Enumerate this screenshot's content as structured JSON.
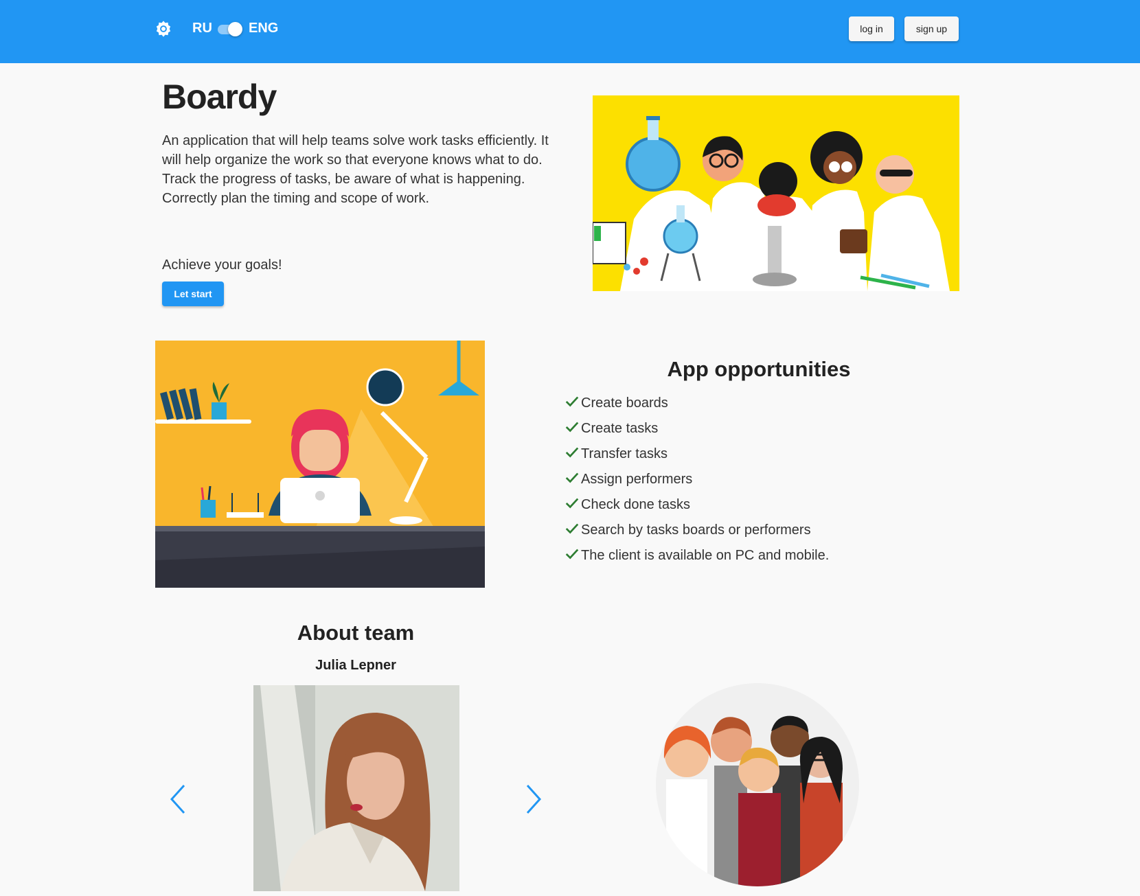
{
  "header": {
    "theme_icon": "gear-icon",
    "lang_ru": "RU",
    "lang_eng": "ENG",
    "lang_toggle_on": true,
    "login_label": "log in",
    "signup_label": "sign up"
  },
  "hero": {
    "title": "Boardy",
    "description": "An application that will help teams solve work tasks efficiently. It will help organize the work so that everyone knows what to do. Track the progress of tasks, be aware of what is happening. Correctly plan the timing and scope of work.",
    "goals": "Achieve your goals!",
    "start_label": "Let start"
  },
  "opportunities": {
    "title": "App opportunities",
    "items": [
      "Create boards",
      "Create tasks",
      "Transfer tasks",
      "Assign performers",
      "Check done tasks",
      "Search by tasks boards or performers",
      "The client is available on PC and mobile."
    ]
  },
  "team": {
    "title": "About team",
    "member_name": "Julia Lepner",
    "prev_icon": "chevron-left-icon",
    "next_icon": "chevron-right-icon"
  },
  "colors": {
    "primary": "#2196f3",
    "check": "#2e7d32",
    "background": "#f9f9f9",
    "hero_bg": "#fce000",
    "desk_bg": "#f9b62c"
  }
}
